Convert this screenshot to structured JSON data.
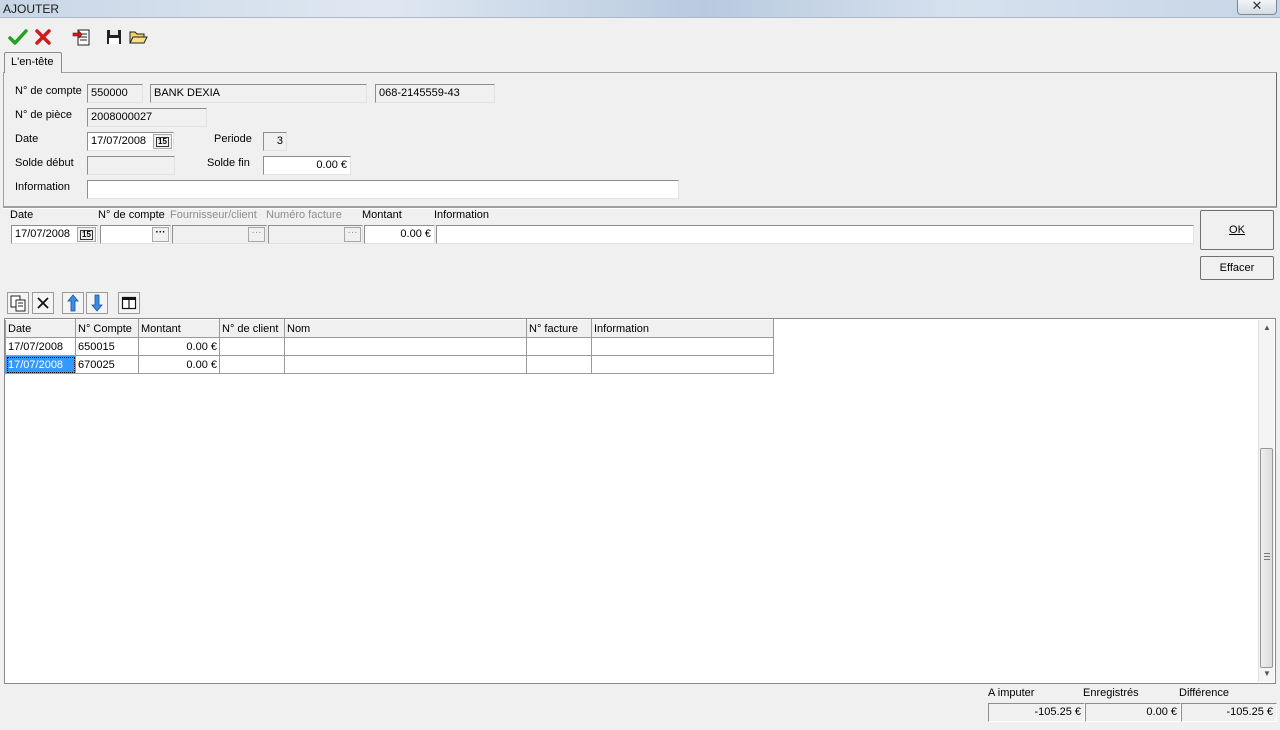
{
  "window": {
    "title": "AJOUTER",
    "close_glyph": "✕"
  },
  "toolbar": {
    "buttons": [
      {
        "name": "confirm-button",
        "icon": "checkmark-icon"
      },
      {
        "name": "cancel-button",
        "icon": "red-x-icon"
      },
      {
        "name": "import-button",
        "icon": "import-document-icon"
      },
      {
        "name": "save-button",
        "icon": "floppy-disk-icon"
      },
      {
        "name": "open-button",
        "icon": "open-folder-icon"
      }
    ]
  },
  "tabs": [
    {
      "label": "L'en-tête"
    }
  ],
  "header": {
    "account_label": "N° de compte",
    "account_number": "550000",
    "account_name": "BANK DEXIA",
    "bank_account": "068-2145559-43",
    "piece_label": "N° de pièce",
    "piece_number": "2008000027",
    "date_label": "Date",
    "date_value": "17/07/2008",
    "period_label": "Periode",
    "period_value": "3",
    "start_balance_label": "Solde début",
    "start_balance_value": "",
    "end_balance_label": "Solde fin",
    "end_balance_value": "0.00 €",
    "info_label": "Information",
    "info_value": ""
  },
  "entry": {
    "date_label": "Date",
    "account_label": "N° de compte",
    "supplier_label": "Fournisseur/client",
    "invoice_label": "Numéro facture",
    "amount_label": "Montant",
    "info_label": "Information",
    "date_value": "17/07/2008",
    "account_value": "",
    "supplier_value": "",
    "invoice_value": "",
    "amount_value": "0.00 €",
    "info_value": "",
    "ok_label": "OK",
    "clear_label": "Effacer",
    "ellipsis": "···",
    "calendar_glyph": "15"
  },
  "grid": {
    "columns": [
      "Date",
      "N° Compte",
      "Montant",
      "N° de client",
      "Nom",
      "N° facture",
      "Information"
    ],
    "rows": [
      [
        "17/07/2008",
        "650015",
        "0.00 €",
        "",
        "",
        "",
        ""
      ],
      [
        "17/07/2008",
        "670025",
        "0.00 €",
        "",
        "",
        "",
        ""
      ]
    ]
  },
  "totals": {
    "to_post_label": "A imputer",
    "recorded_label": "Enregistrés",
    "difference_label": "Différence",
    "to_post_value": "-105.25 €",
    "recorded_value": "0.00 €",
    "difference_value": "-105.25 €"
  },
  "colors": {
    "selection": "#3399ff",
    "accept_green": "#1fa21f",
    "cancel_red": "#d11a1a"
  }
}
